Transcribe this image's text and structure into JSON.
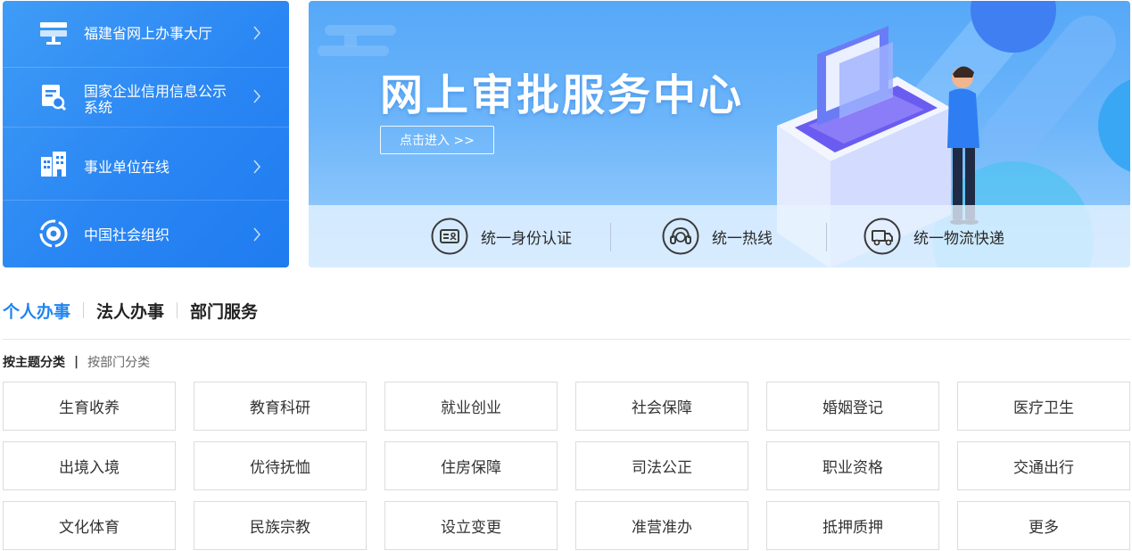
{
  "left_nav": {
    "items": [
      {
        "label": "福建省网上办事大厅",
        "icon": "monitor-icon"
      },
      {
        "label": "国家企业信用信息公示系统",
        "icon": "document-search-icon"
      },
      {
        "label": "事业单位在线",
        "icon": "building-icon"
      },
      {
        "label": "中国社会组织",
        "icon": "circle-globe-icon"
      }
    ]
  },
  "banner": {
    "title": "网上审批服务中心",
    "enter_label": "点击进入 >>",
    "services": [
      {
        "label": "统一身份认证",
        "icon": "id-card-icon"
      },
      {
        "label": "统一热线",
        "icon": "headset-icon"
      },
      {
        "label": "统一物流快递",
        "icon": "delivery-truck-icon"
      }
    ]
  },
  "tabs": [
    {
      "label": "个人办事",
      "active": true
    },
    {
      "label": "法人办事",
      "active": false
    },
    {
      "label": "部门服务",
      "active": false
    }
  ],
  "filter": {
    "active_label": "按主题分类",
    "separator": "|",
    "inactive_label": "按部门分类"
  },
  "categories": [
    "生育收养",
    "教育科研",
    "就业创业",
    "社会保障",
    "婚姻登记",
    "医疗卫生",
    "出境入境",
    "优待抚恤",
    "住房保障",
    "司法公正",
    "职业资格",
    "交通出行",
    "文化体育",
    "民族宗教",
    "设立变更",
    "准营准办",
    "抵押质押",
    "更多"
  ],
  "colors": {
    "accent": "#1f84f0",
    "nav_bg": "#2a86f3",
    "banner_bg": "#6cb5fa"
  }
}
